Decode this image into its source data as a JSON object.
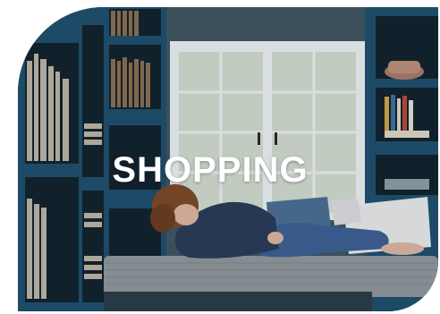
{
  "category_tile": {
    "label": "SHOPPING",
    "image": {
      "alt": "",
      "colors": {
        "shelf_blue": "#1f4f6d",
        "wall": "#3f5560",
        "window_frame": "#e7ecef",
        "window_glass": "#cfd8cc",
        "sofa": "#8f969c",
        "shirt": "#2a3c58",
        "jeans": "#3c5f92",
        "hair": "#7a4a2a",
        "cushion": "#e4e6e8"
      }
    }
  }
}
